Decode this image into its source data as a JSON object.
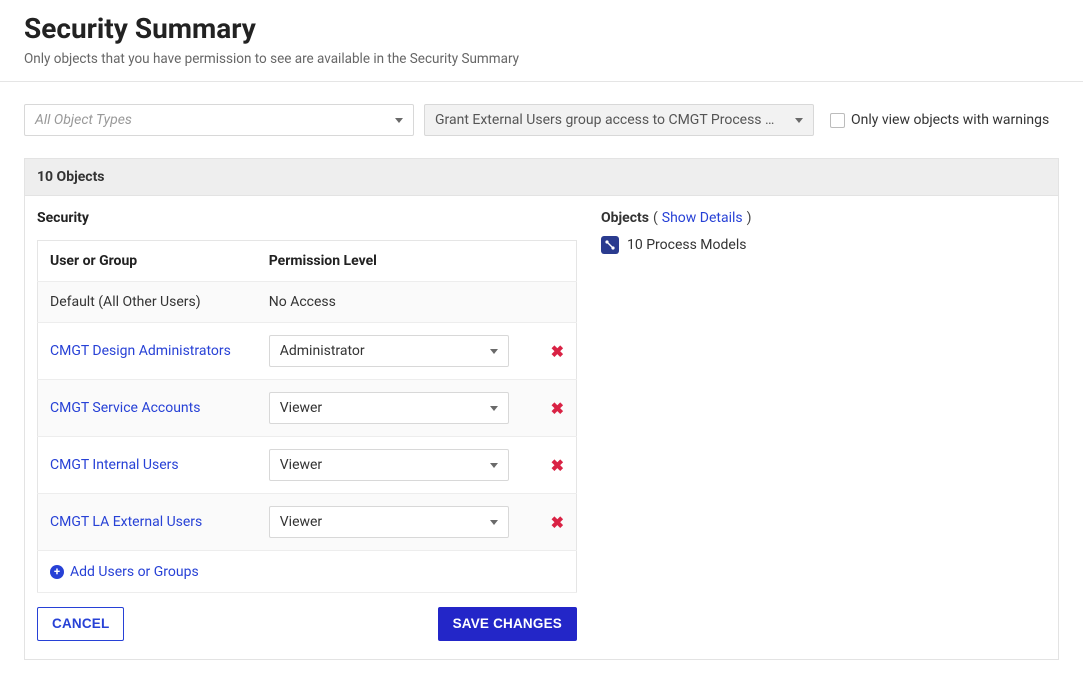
{
  "header": {
    "title": "Security Summary",
    "subtitle": "Only objects that you have permission to see are available in the Security Summary"
  },
  "filters": {
    "objectTypes": {
      "placeholder": "All Object Types"
    },
    "scope": {
      "value": "Grant External Users group access to CMGT Process ..."
    },
    "warningsOnly": {
      "label": "Only view objects with warnings"
    }
  },
  "panel": {
    "countLabel": "10 Objects",
    "securityTitle": "Security",
    "columns": {
      "userGroup": "User or Group",
      "permission": "Permission Level"
    },
    "defaultRow": {
      "label": "Default (All Other Users)",
      "permission": "No Access"
    },
    "rows": [
      {
        "group": "CMGT Design Administrators",
        "permission": "Administrator"
      },
      {
        "group": "CMGT Service Accounts",
        "permission": "Viewer"
      },
      {
        "group": "CMGT Internal Users",
        "permission": "Viewer"
      },
      {
        "group": "CMGT LA External Users",
        "permission": "Viewer"
      }
    ],
    "addLabel": "Add Users or Groups",
    "cancelLabel": "CANCEL",
    "saveLabel": "SAVE CHANGES"
  },
  "objects": {
    "title": "Objects",
    "showDetails": "Show Details",
    "listLabel": "10 Process Models"
  }
}
